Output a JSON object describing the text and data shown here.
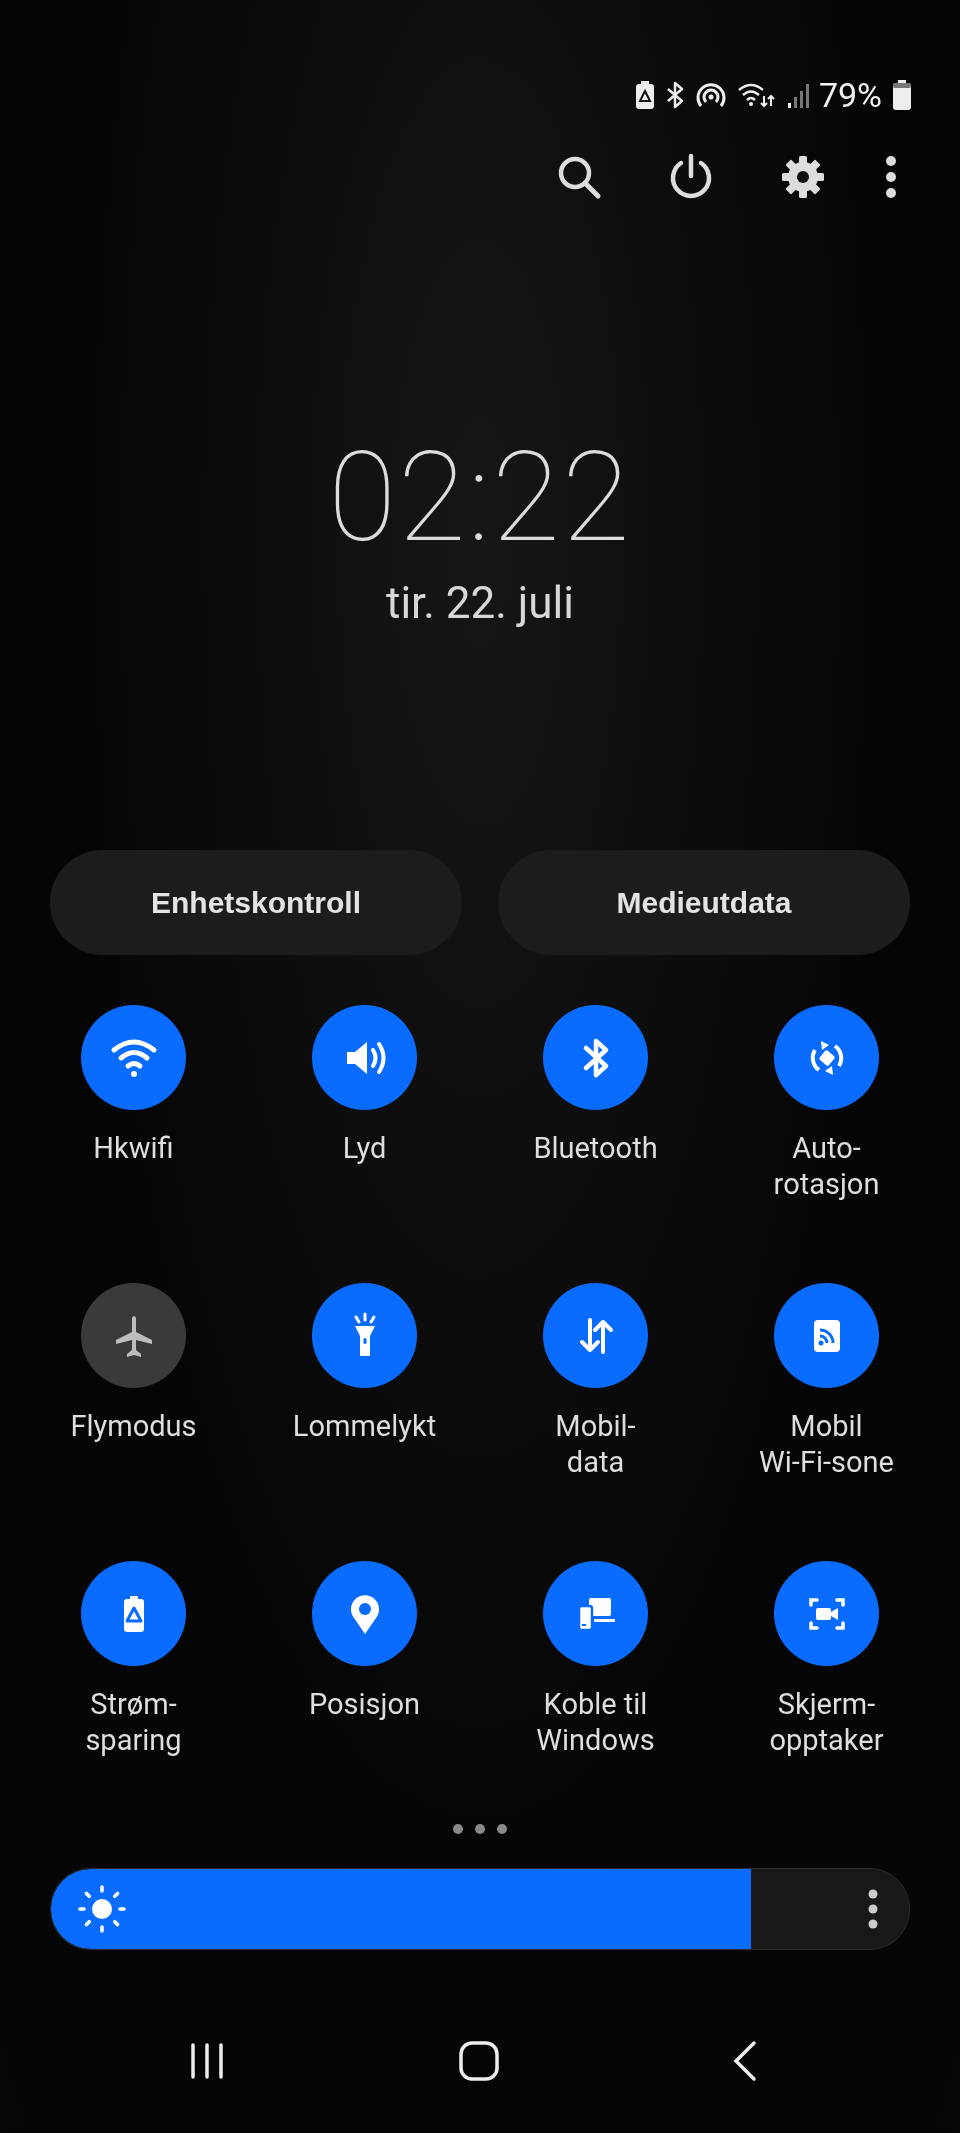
{
  "status_bar": {
    "battery_percent": "79%"
  },
  "clock": {
    "time": "02:22",
    "date": "tir. 22. juli"
  },
  "panel_buttons": [
    "Enhetskontroll",
    "Medieutdata"
  ],
  "tiles": [
    {
      "kind": "wifi",
      "label": "Hkwifi",
      "on": true
    },
    {
      "kind": "sound",
      "label": "Lyd",
      "on": true
    },
    {
      "kind": "bluetooth",
      "label": "Bluetooth",
      "on": true
    },
    {
      "kind": "rotate",
      "label": "Auto-\nrotasjon",
      "on": true
    },
    {
      "kind": "airplane",
      "label": "Flymodus",
      "on": false
    },
    {
      "kind": "flashlight",
      "label": "Lommelykt",
      "on": true
    },
    {
      "kind": "data",
      "label": "Mobil-\ndata",
      "on": true
    },
    {
      "kind": "hotspot",
      "label": "Mobil\nWi-Fi-sone",
      "on": true
    },
    {
      "kind": "battery",
      "label": "Strøm-\nsparing",
      "on": true
    },
    {
      "kind": "location",
      "label": "Posisjon",
      "on": true
    },
    {
      "kind": "link",
      "label": "Koble til\nWindows",
      "on": true
    },
    {
      "kind": "recorder",
      "label": "Skjerm-\nopptaker",
      "on": true
    }
  ],
  "brightness": {
    "level": 0.816
  }
}
